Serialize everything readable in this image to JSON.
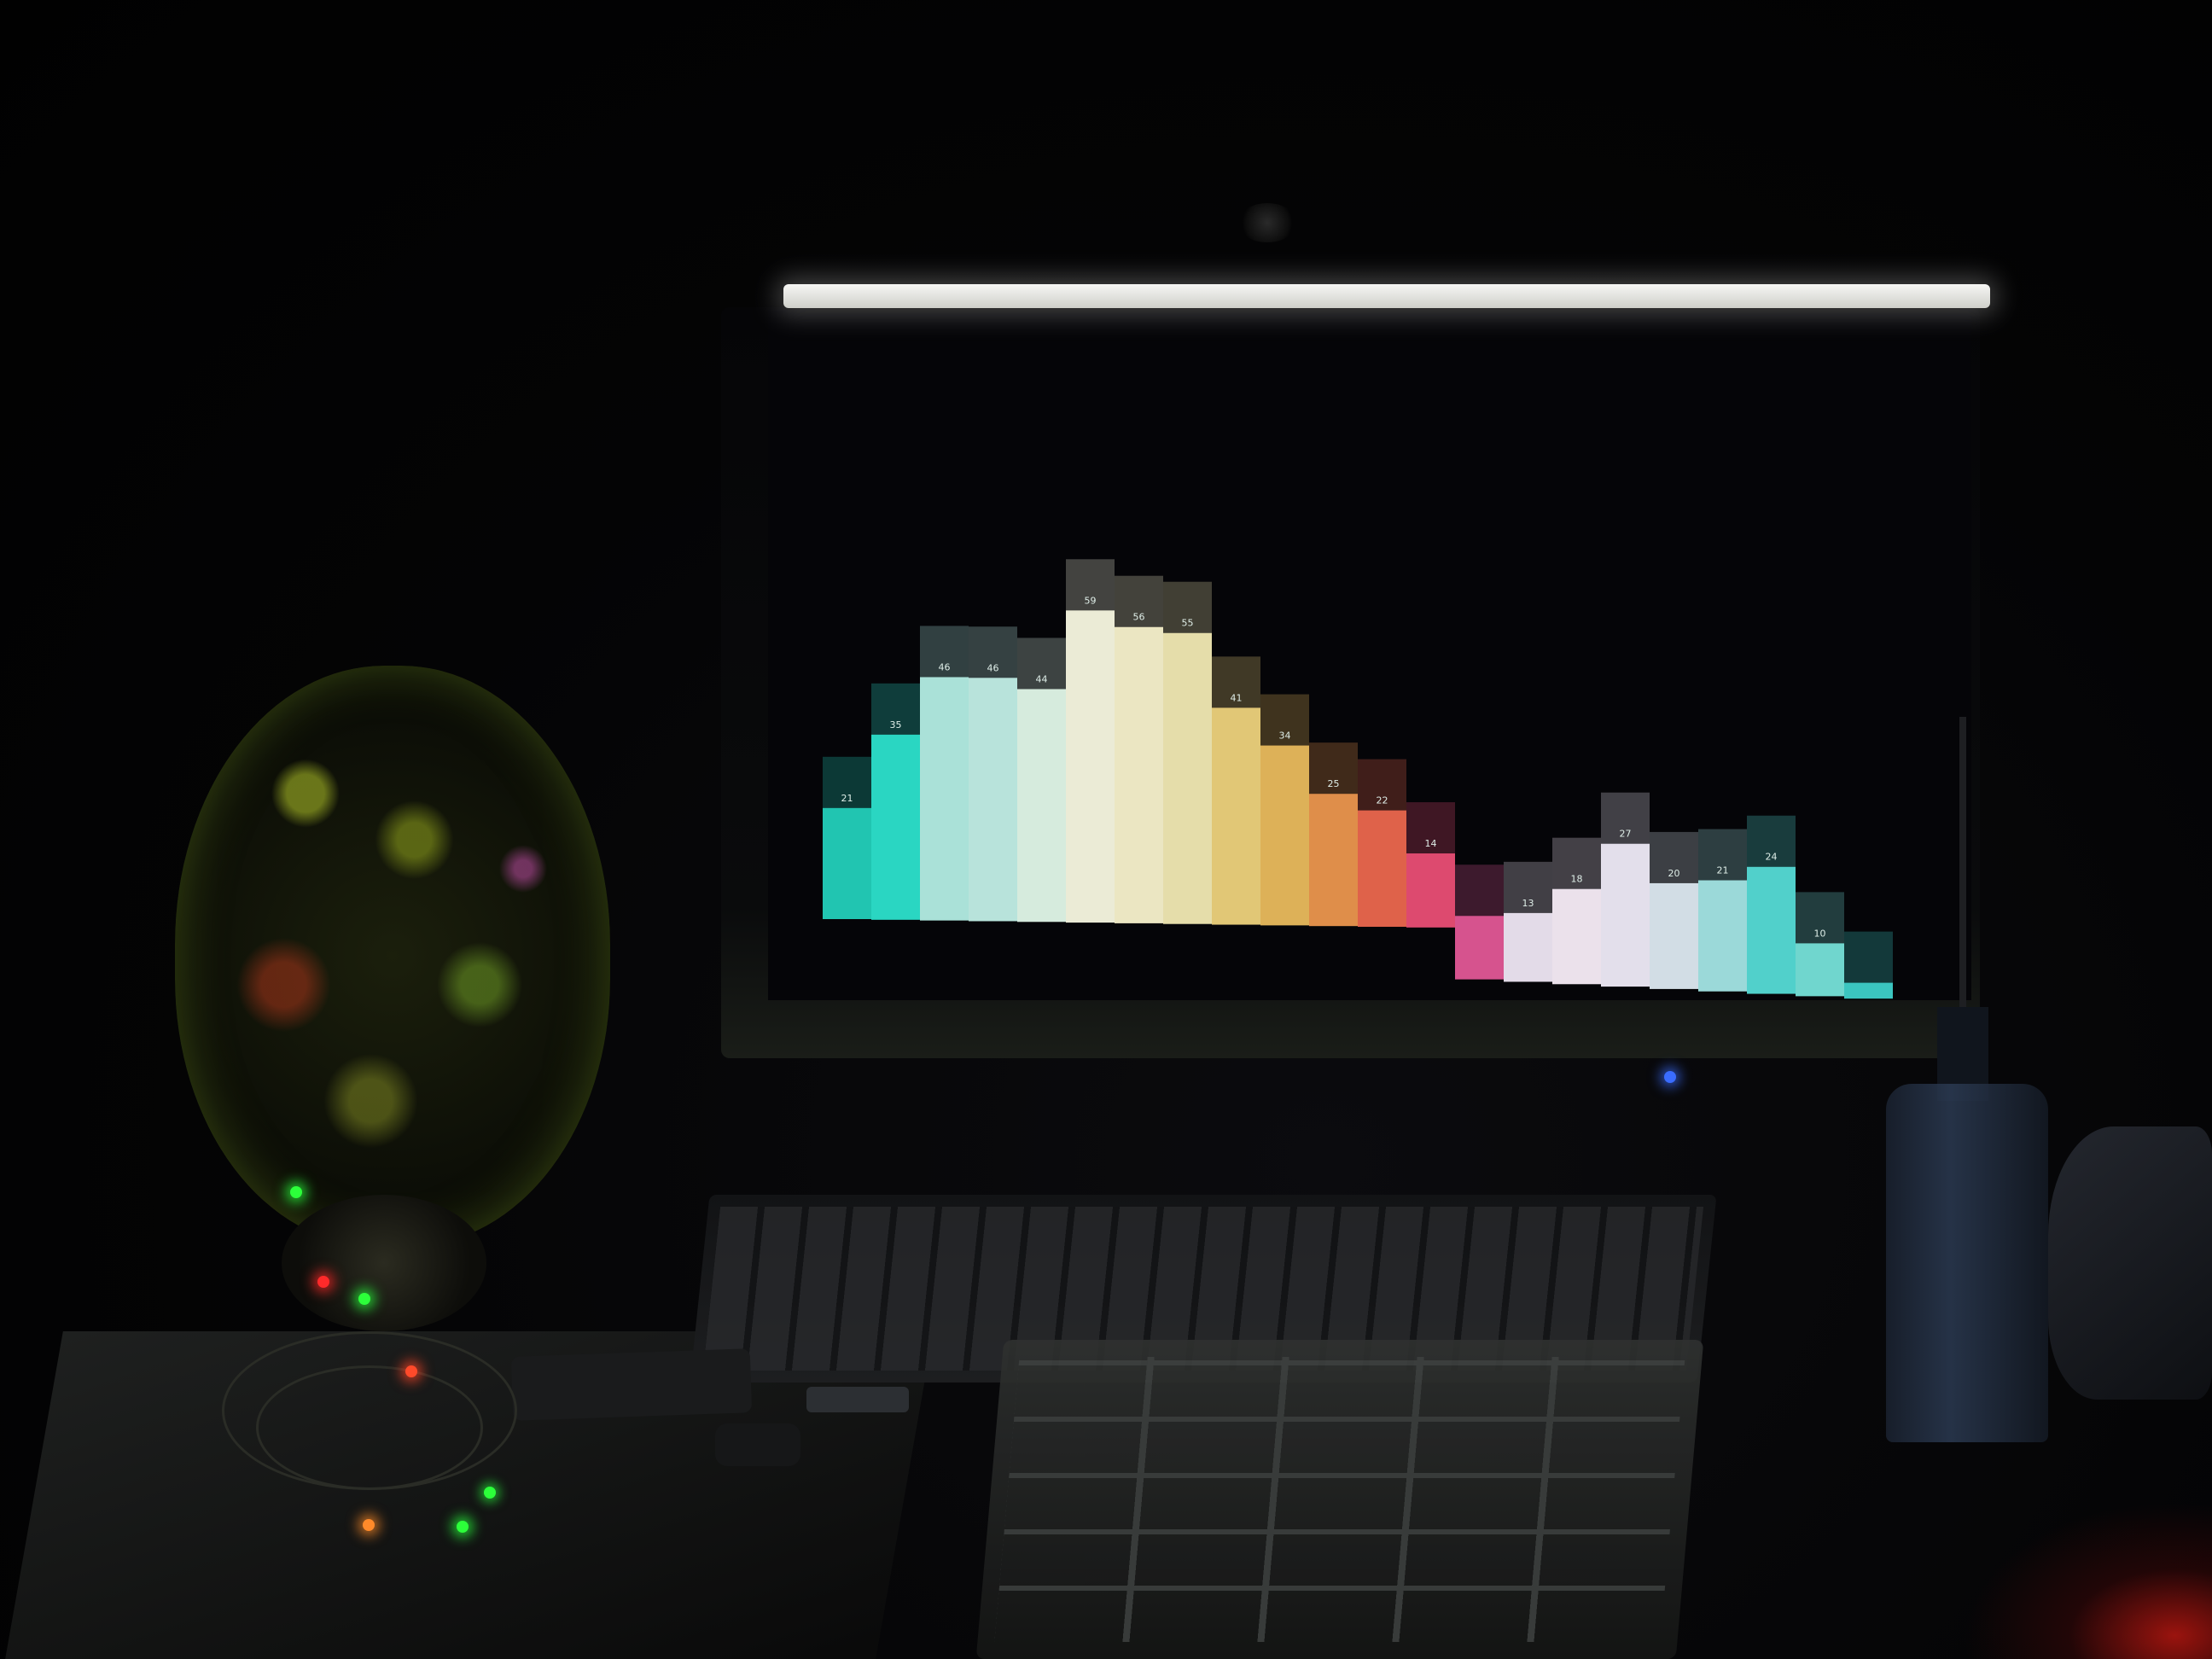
{
  "scene": {
    "description_visible_text": "",
    "screen_visualizer": {
      "bar_labels": [
        "21",
        "35",
        "46",
        "46",
        "44",
        "59",
        "56",
        "55",
        "41",
        "34",
        "25",
        "22",
        "14",
        "",
        "13",
        "18",
        "27",
        "20",
        "21",
        "24",
        "10",
        ""
      ],
      "bar_values": [
        21,
        35,
        46,
        46,
        44,
        59,
        56,
        55,
        41,
        34,
        25,
        22,
        14,
        12,
        13,
        18,
        27,
        20,
        21,
        24,
        10,
        3
      ],
      "colors": [
        "#24d6c0",
        "#2ee8d2",
        "#b9f4ea",
        "#c8f6ee",
        "#e8fff0",
        "#ffffe8",
        "#fffad2",
        "#f8f0b8",
        "#f4d880",
        "#f0c060",
        "#f29a50",
        "#f26a50",
        "#f05078",
        "#e85a9a",
        "#f6eefc",
        "#fff4ff",
        "#f6f2ff",
        "#e4f0f8",
        "#a8ecec",
        "#58e2dc",
        "#7ae8e0",
        "#40d6d0"
      ]
    },
    "icons": [
      "webcam-icon",
      "power-led-icon"
    ],
    "accent_colors": {
      "light_bar": "#f6f6f4",
      "power_led": "#3a6cff",
      "red_glow": "#ff1e14"
    }
  }
}
